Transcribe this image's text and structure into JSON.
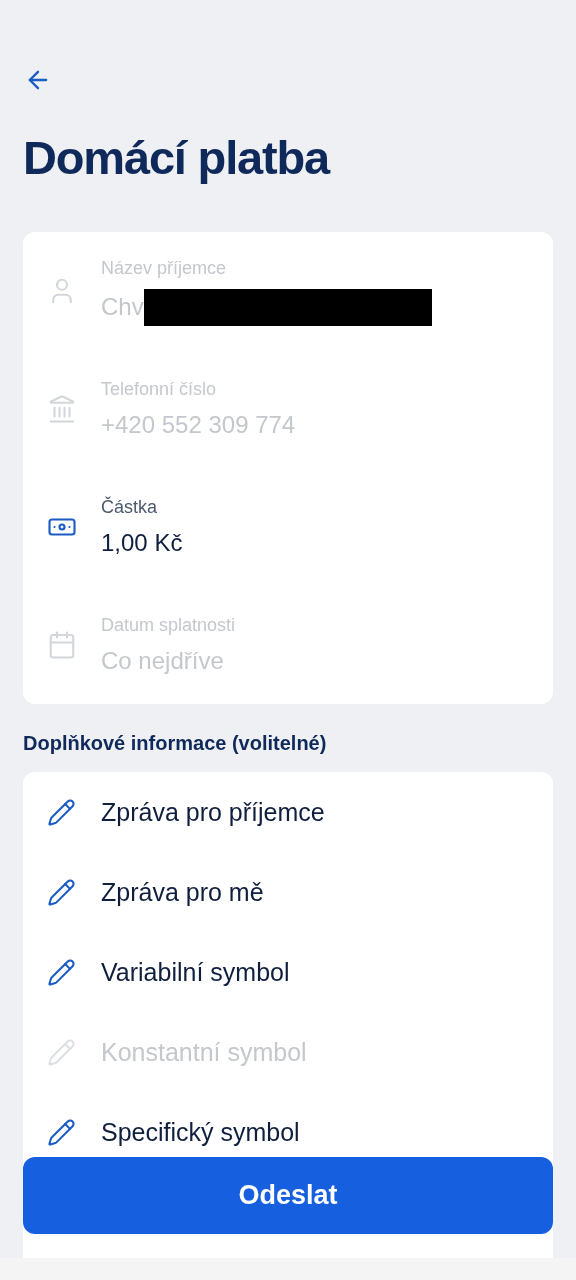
{
  "title": "Domácí platba",
  "fields": [
    {
      "label": "Název příjemce",
      "value": "Chv",
      "redacted": true,
      "disabled": true
    },
    {
      "label": "Telefonní číslo",
      "value": "+420 552 309 774",
      "disabled": true
    },
    {
      "label": "Částka",
      "value": "1,00 Kč",
      "disabled": false
    },
    {
      "label": "Datum splatnosti",
      "value": "Co nejdříve",
      "disabled": true
    }
  ],
  "section_title": "Doplňkové informace (volitelné)",
  "options": [
    {
      "label": "Zpráva pro příjemce",
      "disabled": false
    },
    {
      "label": "Zpráva pro mě",
      "disabled": false
    },
    {
      "label": "Variabilní symbol",
      "disabled": false
    },
    {
      "label": "Konstantní symbol",
      "disabled": true
    },
    {
      "label": "Specifický symbol",
      "disabled": false
    }
  ],
  "submit": "Odeslat"
}
